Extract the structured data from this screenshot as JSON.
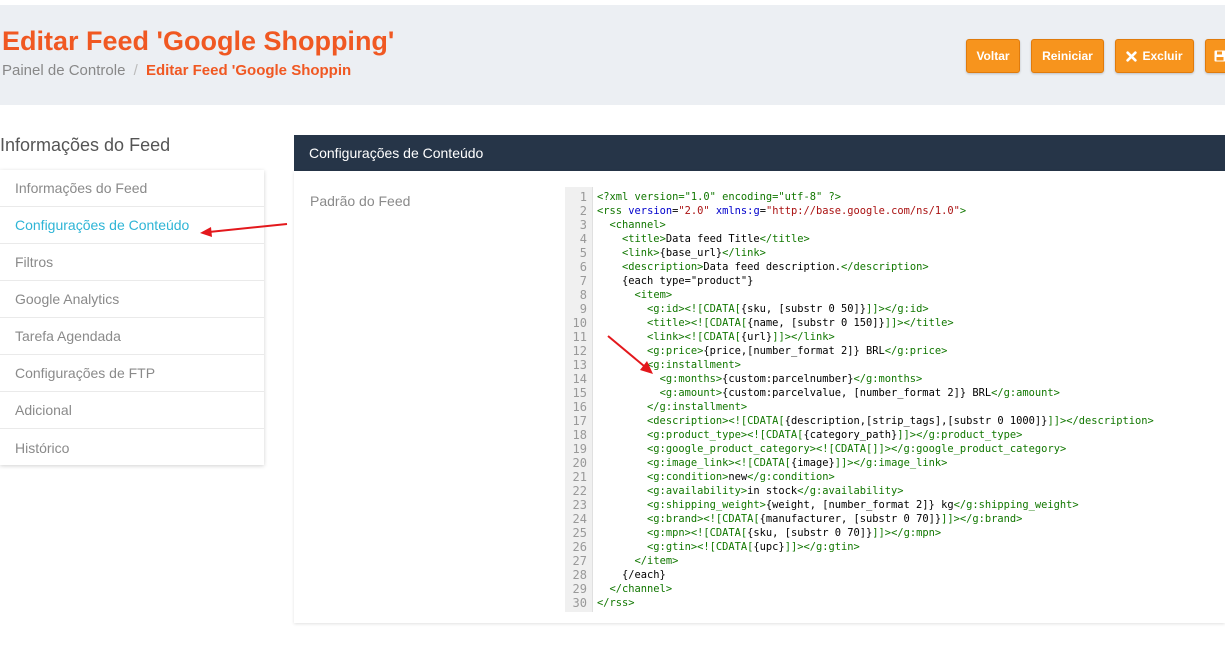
{
  "header": {
    "title": "Editar Feed 'Google Shopping'",
    "breadcrumb_home": "Painel de Controle",
    "breadcrumb_sep": "/",
    "breadcrumb_current": "Editar Feed 'Google Shoppin"
  },
  "buttons": {
    "back": "Voltar",
    "restart": "Reiniciar",
    "delete": "Excluir"
  },
  "sidebar": {
    "title": "Informações do Feed",
    "items": [
      {
        "label": "Informações do Feed"
      },
      {
        "label": "Configurações de Conteúdo",
        "active": true
      },
      {
        "label": "Filtros"
      },
      {
        "label": "Google Analytics"
      },
      {
        "label": "Tarefa Agendada"
      },
      {
        "label": "Configurações de FTP"
      },
      {
        "label": "Adicional"
      },
      {
        "label": "Histórico"
      }
    ]
  },
  "panel": {
    "title": "Configurações de Conteúdo",
    "field_label": "Padrão do Feed"
  },
  "code_lines": [
    "<?xml version=\"1.0\" encoding=\"utf-8\" ?>",
    "<rss version=\"2.0\" xmlns:g=\"http://base.google.com/ns/1.0\">",
    "  <channel>",
    "    <title>Data feed Title</title>",
    "    <link>{base_url}</link>",
    "    <description>Data feed description.</description>",
    "    {each type=\"product\"}",
    "      <item>",
    "        <g:id><![CDATA[{sku, [substr 0 50]}]]></g:id>",
    "        <title><![CDATA[{name, [substr 0 150]}]]></title>",
    "        <link><![CDATA[{url}]]></link>",
    "        <g:price>{price,[number_format 2]} BRL</g:price>",
    "        <g:installment>",
    "          <g:months>{custom:parcelnumber}</g:months>",
    "          <g:amount>{custom:parcelvalue, [number_format 2]} BRL</g:amount>",
    "        </g:installment>",
    "        <description><![CDATA[{description,[strip_tags],[substr 0 1000]}]]></description>",
    "        <g:product_type><![CDATA[{category_path}]]></g:product_type>",
    "        <g:google_product_category><![CDATA[]]></g:google_product_category>",
    "        <g:image_link><![CDATA[{image}]]></g:image_link>",
    "        <g:condition>new</g:condition>",
    "        <g:availability>in stock</g:availability>",
    "        <g:shipping_weight>{weight, [number_format 2]} kg</g:shipping_weight>",
    "        <g:brand><![CDATA[{manufacturer, [substr 0 70]}]]></g:brand>",
    "        <g:mpn><![CDATA[{sku, [substr 0 70]}]]></g:mpn>",
    "        <g:gtin><![CDATA[{upc}]]></g:gtin>",
    "      </item>",
    "    {/each}",
    "  </channel>",
    "</rss>"
  ],
  "colors": {
    "accent_orange": "#f05822",
    "button_orange": "#f7941d",
    "panel_header": "#263548",
    "active_link": "#2eb5d6",
    "annotation_arrow": "#e3181c"
  },
  "icons": {
    "delete": "close-icon",
    "save": "save-icon"
  }
}
